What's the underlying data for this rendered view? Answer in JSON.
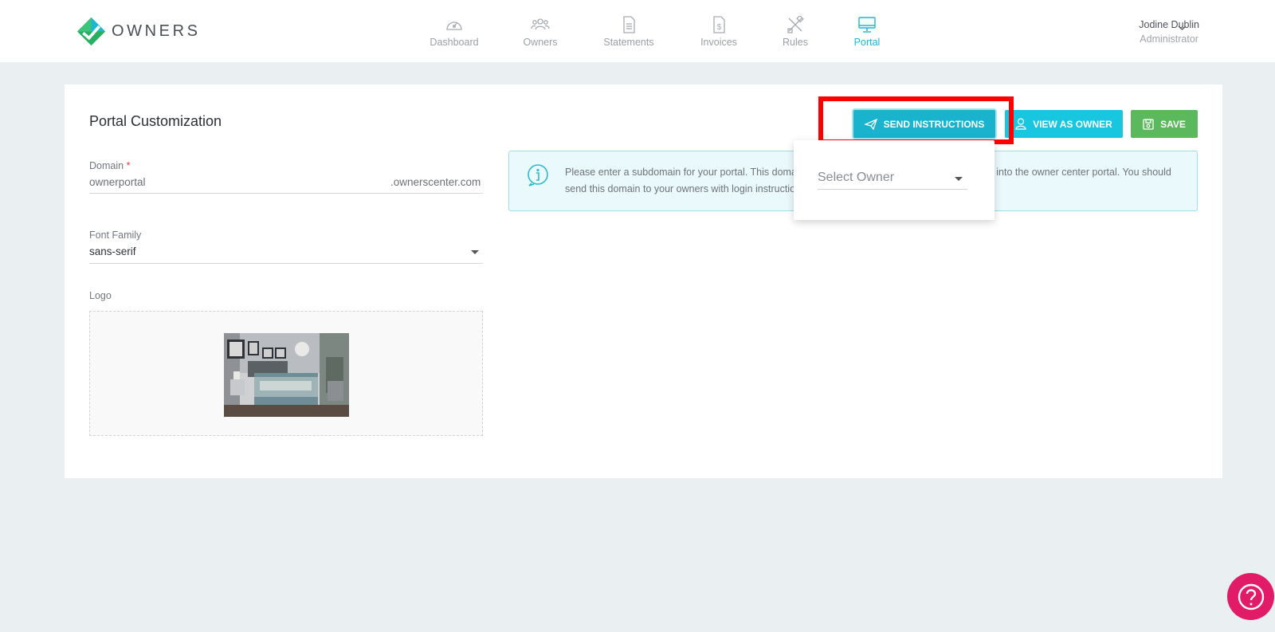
{
  "app": {
    "brand": "OWNERS",
    "brand_color": "#1bb8d0"
  },
  "nav": {
    "items": [
      {
        "label": "Dashboard",
        "icon": "dashboard-gauge-icon",
        "active": false
      },
      {
        "label": "Owners",
        "icon": "users-group-icon",
        "active": false
      },
      {
        "label": "Statements",
        "icon": "document-icon",
        "active": false
      },
      {
        "label": "Invoices",
        "icon": "invoice-dollar-icon",
        "active": false
      },
      {
        "label": "Rules",
        "icon": "tools-crossed-icon",
        "active": true
      },
      {
        "label": "Portal",
        "icon": "monitor-icon",
        "active": true
      }
    ]
  },
  "user": {
    "name": "Jodine Dublin",
    "role": "Administrator"
  },
  "page": {
    "title": "Portal Customization"
  },
  "form": {
    "domain_label": "Domain",
    "domain_required_mark": "*",
    "domain_value": "ownerportal",
    "domain_suffix": ".ownerscenter.com",
    "font_label": "Font Family",
    "font_value": "sans-serif",
    "logo_label": "Logo"
  },
  "alert": {
    "text": "Please enter a subdomain for your portal. This domain will be the URL your owners will use to log into the owner center portal. You should send this domain to your owners with login instructions."
  },
  "buttons": {
    "send": "SEND INSTRUCTIONS",
    "view": "VIEW AS OWNER",
    "save": "SAVE"
  },
  "popup": {
    "select_placeholder": "Select Owner"
  },
  "colors": {
    "send_button": "#19b3cd",
    "view_button": "#19c6e0",
    "save_button": "#5cb85c",
    "highlight": "#ff0000",
    "help_button": "#e11b67"
  }
}
